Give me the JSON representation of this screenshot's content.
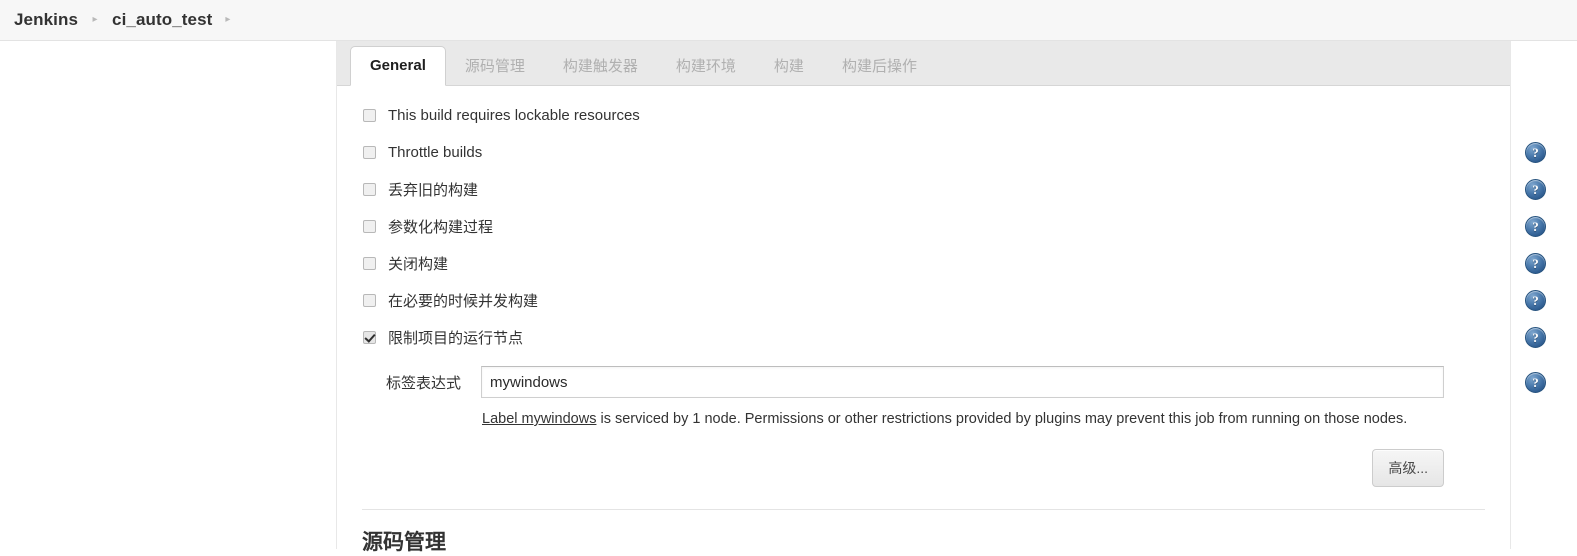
{
  "breadcrumb": {
    "items": [
      {
        "label": "Jenkins"
      },
      {
        "label": "ci_auto_test"
      }
    ],
    "separator": "▸"
  },
  "tabs": [
    {
      "label": "General",
      "active": true
    },
    {
      "label": "源码管理",
      "active": false
    },
    {
      "label": "构建触发器",
      "active": false
    },
    {
      "label": "构建环境",
      "active": false
    },
    {
      "label": "构建",
      "active": false
    },
    {
      "label": "构建后操作",
      "active": false
    }
  ],
  "options": [
    {
      "label": "This build requires lockable resources",
      "checked": false,
      "help": false
    },
    {
      "label": "Throttle builds",
      "checked": false,
      "help": true
    },
    {
      "label": "丢弃旧的构建",
      "checked": false,
      "help": true
    },
    {
      "label": "参数化构建过程",
      "checked": false,
      "help": true
    },
    {
      "label": "关闭构建",
      "checked": false,
      "help": true
    },
    {
      "label": "在必要的时候并发构建",
      "checked": false,
      "help": true
    },
    {
      "label": "限制项目的运行节点",
      "checked": true,
      "help": true
    }
  ],
  "label_expression": {
    "field_label": "标签表达式",
    "value": "mywindows",
    "placeholder": "",
    "note_link": "Label mywindows",
    "note_rest": " is serviced by 1 node. Permissions or other restrictions provided by plugins may prevent this job from running on those nodes."
  },
  "advanced_button": {
    "label": "高级..."
  },
  "section": {
    "heading": "源码管理"
  },
  "icons": {
    "help": "?"
  },
  "colors": {
    "help_icon_blue": "#2f5d91",
    "tabbar_bg": "#e9e9e9",
    "breadcrumb_bg": "#f7f7f7",
    "text": "#333333"
  }
}
